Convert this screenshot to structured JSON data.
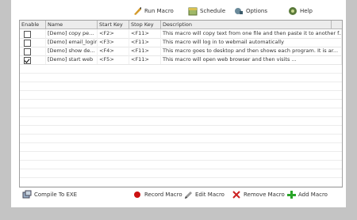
{
  "toolbar": {
    "run_macro": "Run Macro",
    "schedule": "Schedule",
    "options": "Options",
    "help": "Help"
  },
  "table": {
    "headers": [
      "Enable",
      "Name",
      "Start Key",
      "Stop Key",
      "Description"
    ],
    "rows": [
      {
        "enabled": false,
        "name": "[Demo] copy pe...",
        "start": "<F2>",
        "stop": "<F11>",
        "desc": "This macro will copy text from one file and then paste it to another f..."
      },
      {
        "enabled": false,
        "name": "[Demo] email_login",
        "start": "<F3>",
        "stop": "<F11>",
        "desc": "This macro will log in to webmail automatically"
      },
      {
        "enabled": false,
        "name": "[Demo] show de...",
        "start": "<F4>",
        "stop": "<F11>",
        "desc": "This macro goes to desktop and then shows each program. It is ar..."
      },
      {
        "enabled": true,
        "name": "[Demo] start web",
        "start": "<F5>",
        "stop": "<F11>",
        "desc": "This macro will open web browser and then visits ..."
      }
    ]
  },
  "footer": {
    "compile": "Compile To EXE",
    "record": "Record Macro",
    "edit": "Edit Macro",
    "remove": "Remove Macro",
    "add": "Add Macro"
  },
  "colors": {
    "record_dot": "#cc1111",
    "remove_x": "#cc2222",
    "add_plus": "#2aa52a"
  }
}
